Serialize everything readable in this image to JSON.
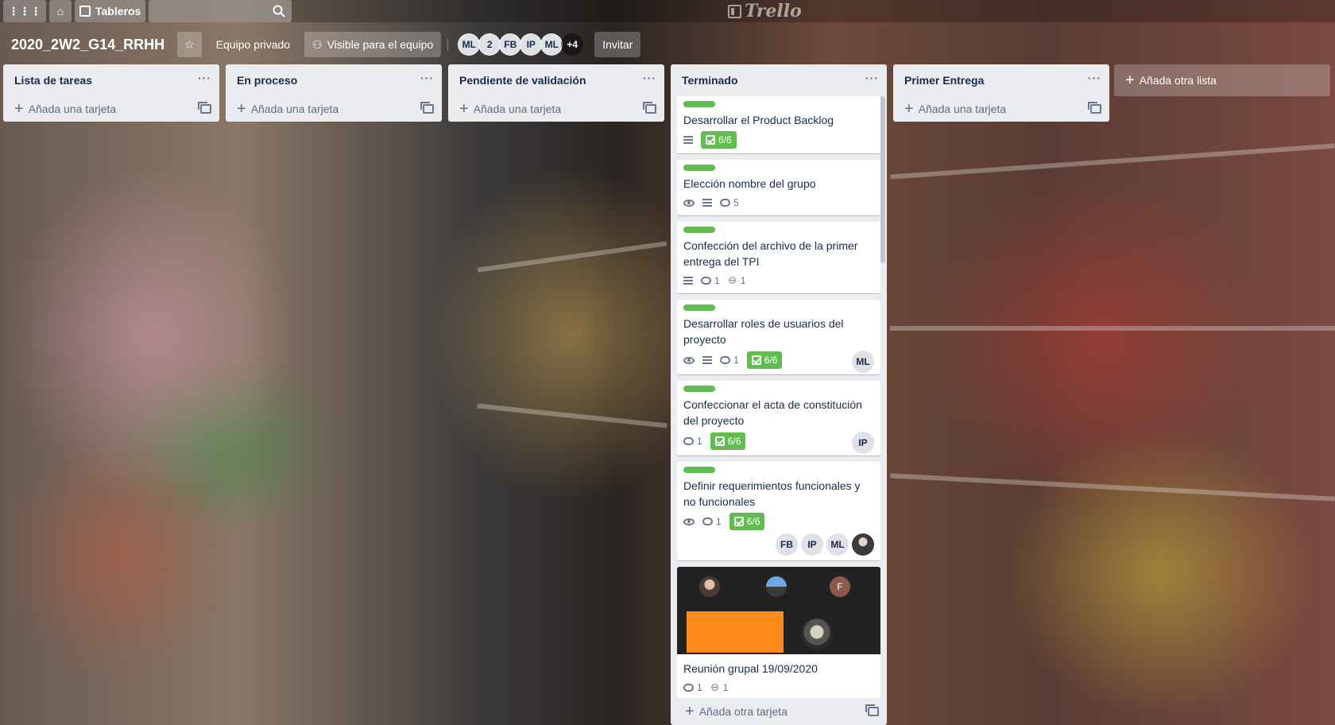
{
  "header": {
    "boards_label": "Tableros",
    "logo_text": "Trello"
  },
  "board": {
    "title": "2020_2W2_G14_RRHH",
    "team_label": "Equipo privado",
    "visibility_label": "Visible para el equipo",
    "members": [
      "ML",
      "2",
      "FB",
      "IP",
      "ML"
    ],
    "members_more": "+4",
    "invite_label": "Invitar"
  },
  "lists": [
    {
      "title": "Lista de tareas",
      "add_label": "Añada una tarjeta"
    },
    {
      "title": "En proceso",
      "add_label": "Añada una tarjeta"
    },
    {
      "title": "Pendiente de validación",
      "add_label": "Añada una tarjeta"
    },
    {
      "title": "Terminado",
      "add_label": "Añada otra tarjeta"
    },
    {
      "title": "Primer Entrega",
      "add_label": "Añada una tarjeta"
    }
  ],
  "done_cards": [
    {
      "title": "Desarrollar el Product Backlog",
      "checklist": "6/6"
    },
    {
      "title": "Elección nombre del grupo",
      "comments": "5"
    },
    {
      "title": "Confección del archivo de la primer entrega del TPI",
      "comments": "1",
      "attachments": "1"
    },
    {
      "title": "Desarrollar roles de usuarios del proyecto",
      "comments": "1",
      "checklist": "6/6",
      "members": [
        "ML"
      ]
    },
    {
      "title": "Confeccionar el acta de constitución del proyecto",
      "comments": "1",
      "checklist": "6/6",
      "members": [
        "IP"
      ]
    },
    {
      "title": "Definir requerimientos funcionales y no funcionales",
      "comments": "1",
      "checklist": "6/6",
      "members": [
        "FB",
        "IP",
        "ML"
      ]
    },
    {
      "title": "Reunión grupal 19/09/2020",
      "comments": "1",
      "attachments": "1",
      "cover_avatar": "F"
    }
  ],
  "add_list_label": "Añada otra lista",
  "colors": {
    "label_green": "#61bd4f",
    "list_bg": "#ebecf0",
    "cover_orange": "#ff8c1a"
  }
}
